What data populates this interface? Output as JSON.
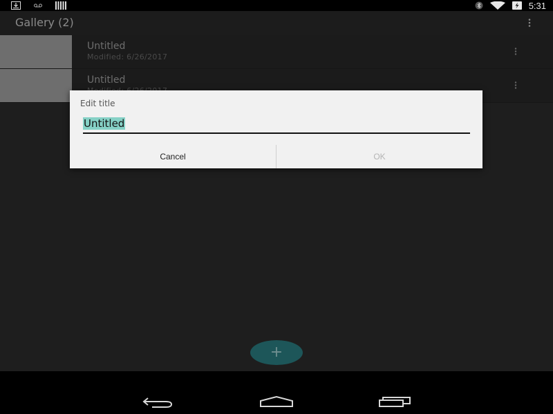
{
  "status_bar": {
    "left_icons": [
      "download-icon",
      "voicemail-icon",
      "signal-bars-icon"
    ],
    "right_icons": [
      "bluetooth-icon",
      "wifi-icon",
      "battery-charging-icon"
    ],
    "time": "5:31"
  },
  "action_bar": {
    "title": "Gallery (2)",
    "overflow_icon": "overflow-menu-icon"
  },
  "gallery": {
    "items": [
      {
        "title": "Untitled",
        "subtitle": "Modified: 6/26/2017"
      },
      {
        "title": "Untitled",
        "subtitle": "Modified: 6/26/2017"
      }
    ]
  },
  "fab": {
    "icon": "plus-icon",
    "label": "+"
  },
  "dialog": {
    "title": "Edit title",
    "input_value": "Untitled",
    "cancel_label": "Cancel",
    "ok_label": "OK",
    "colors": {
      "selection": "#86d1c6",
      "ok_disabled": "#b4b4b4"
    }
  },
  "nav_bar": {
    "buttons": [
      "back-icon",
      "home-icon",
      "recents-icon"
    ]
  },
  "colors": {
    "accent": "#1d5659",
    "background": "#1e1e1e"
  }
}
